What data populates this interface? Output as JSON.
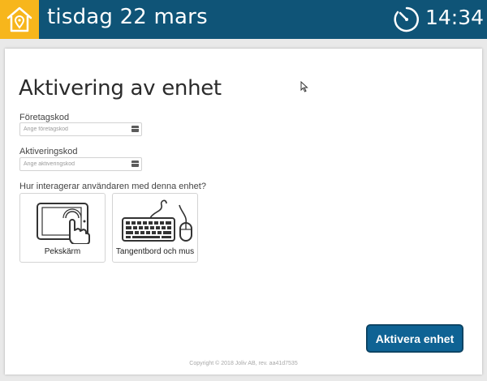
{
  "header": {
    "date": "tisdag 22 mars",
    "time": "14:34",
    "icons": {
      "logo": "house-location-icon",
      "clock": "clock-icon"
    },
    "colors": {
      "background": "#0f5477",
      "logo_background": "#f7b61c"
    }
  },
  "main": {
    "title": "Aktivering av enhet",
    "company_code": {
      "label": "Företagskod",
      "placeholder": "Ange företagskod",
      "value": ""
    },
    "activation_code": {
      "label": "Aktiveringskod",
      "placeholder": "Ange aktiveringskod",
      "value": ""
    },
    "interaction_question": "Hur interagerar användaren med denna enhet?",
    "options": [
      {
        "label": "Pekskärm",
        "icon": "tablet-touch-icon"
      },
      {
        "label": "Tangentbord och mus",
        "icon": "keyboard-mouse-icon"
      }
    ],
    "activate_button": "Aktivera enhet",
    "copyright": "Copyright © 2018 Joliv AB, rev. aa41d7535"
  },
  "colors": {
    "accent": "#0f6394"
  }
}
